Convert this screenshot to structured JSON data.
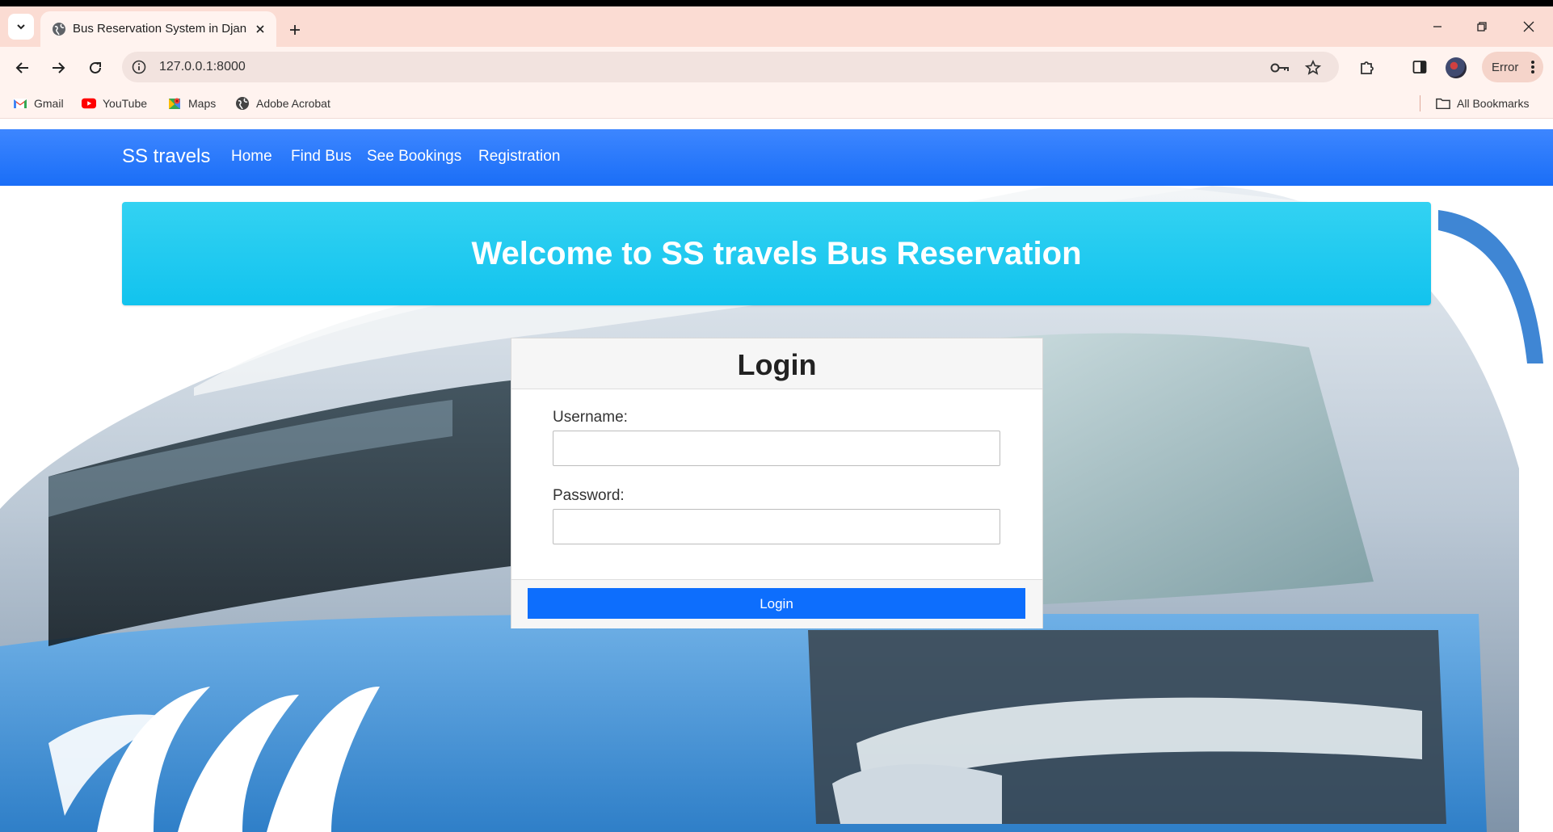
{
  "browser": {
    "tab_title": "Bus Reservation System in Djan",
    "url": "127.0.0.1:8000",
    "error_label": "Error",
    "bookmarks": [
      {
        "label": "Gmail",
        "icon": "gmail-icon"
      },
      {
        "label": "YouTube",
        "icon": "youtube-icon"
      },
      {
        "label": "Maps",
        "icon": "maps-icon"
      },
      {
        "label": "Adobe Acrobat",
        "icon": "globe-icon"
      }
    ],
    "all_bookmarks_label": "All Bookmarks"
  },
  "site": {
    "brand": "SS travels",
    "nav": [
      "Home",
      "Find Bus",
      "See Bookings",
      "Registration"
    ],
    "banner_title": "Welcome to SS travels Bus Reservation",
    "login": {
      "title": "Login",
      "username_label": "Username:",
      "username_value": "",
      "password_label": "Password:",
      "password_value": "",
      "submit_label": "Login"
    }
  },
  "colors": {
    "tabstrip": "#fbdcd3",
    "toolbar": "#fff3ef",
    "navbar": "#1a6ef7",
    "banner": "#12c3ee",
    "primary_button": "#0d6efd"
  }
}
